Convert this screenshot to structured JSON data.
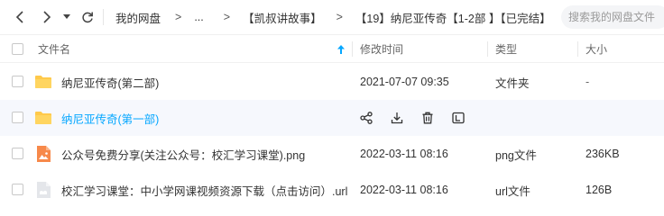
{
  "breadcrumb": {
    "items": [
      "我的网盘",
      "...",
      "【凯叔讲故事】",
      "【19】纳尼亚传奇【1-2部 】【已完结】"
    ],
    "separator": ">"
  },
  "search": {
    "placeholder": "搜索我的网盘文件"
  },
  "columns": {
    "name": "文件名",
    "modified": "修改时间",
    "type": "类型",
    "size": "大小"
  },
  "files": [
    {
      "name": "纳尼亚传奇(第二部)",
      "modified": "2021-07-07 09:35",
      "type": "文件夹",
      "size": "-",
      "icon": "folder-icon"
    },
    {
      "name": "纳尼亚传奇(第一部)",
      "modified": "",
      "type": "",
      "size": "",
      "icon": "folder-icon",
      "hover": true
    },
    {
      "name": "公众号免费分享(关注公众号：校汇学习课堂).png",
      "modified": "2022-03-11 08:16",
      "type": "png文件",
      "size": "236KB",
      "icon": "image-file-icon"
    },
    {
      "name": "校汇学习课堂：中小学网课视频资源下载（点击访问）.url",
      "modified": "2022-03-11 08:16",
      "type": "url文件",
      "size": "126B",
      "icon": "generic-file-icon"
    }
  ],
  "hover_actions": [
    "share-icon",
    "download-icon",
    "delete-icon",
    "rename-icon"
  ],
  "colors": {
    "link": "#06a7ff",
    "folder": "#ffc94a",
    "image_file": "#f7894a",
    "accent": "#06a7ff"
  }
}
